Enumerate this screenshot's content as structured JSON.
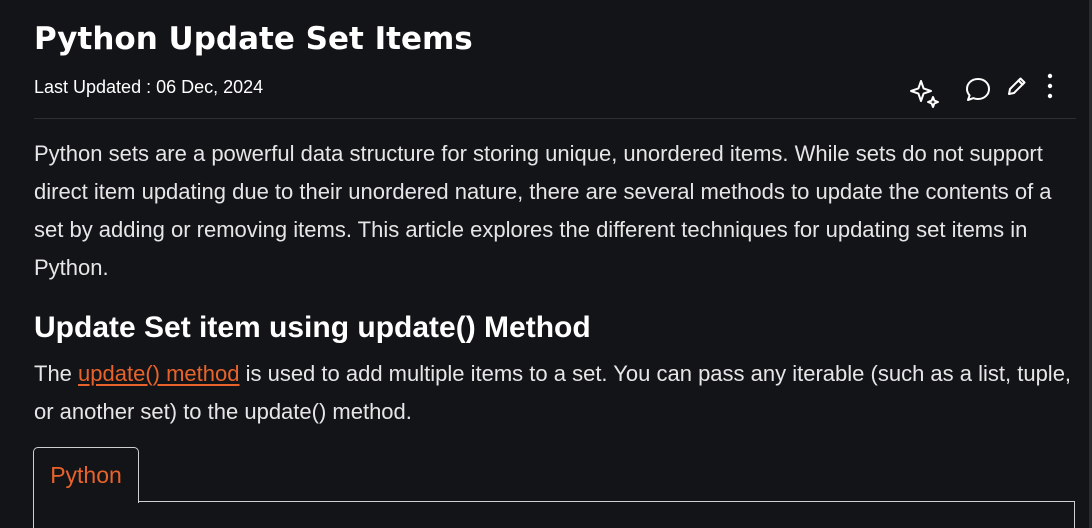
{
  "article": {
    "title": "Python Update Set Items",
    "last_updated_label": "Last Updated : ",
    "last_updated_date": "06 Dec, 2024",
    "intro": "Python sets are a powerful data structure for storing unique, unordered items. While sets do not support direct item updating due to their unordered nature, there are several methods to update the contents of a set by adding or removing items. This article explores the different techniques for updating set items in Python.",
    "section_heading": "Update Set item using update() Method",
    "section_para_prefix": "The ",
    "section_para_link": "update() method",
    "section_para_suffix": " is used to add multiple items to a set. You can pass any iterable (such as a list, tuple, or another set) to the update() method."
  },
  "toolbar": {
    "icons": [
      "sparkle-ai-icon",
      "comment-icon",
      "pencil-edit-icon",
      "more-vertical-icon"
    ]
  },
  "code_block": {
    "tab_label": "Python"
  },
  "colors": {
    "background": "#131417",
    "link_accent": "#e8632b",
    "text": "#e6e6e6"
  }
}
